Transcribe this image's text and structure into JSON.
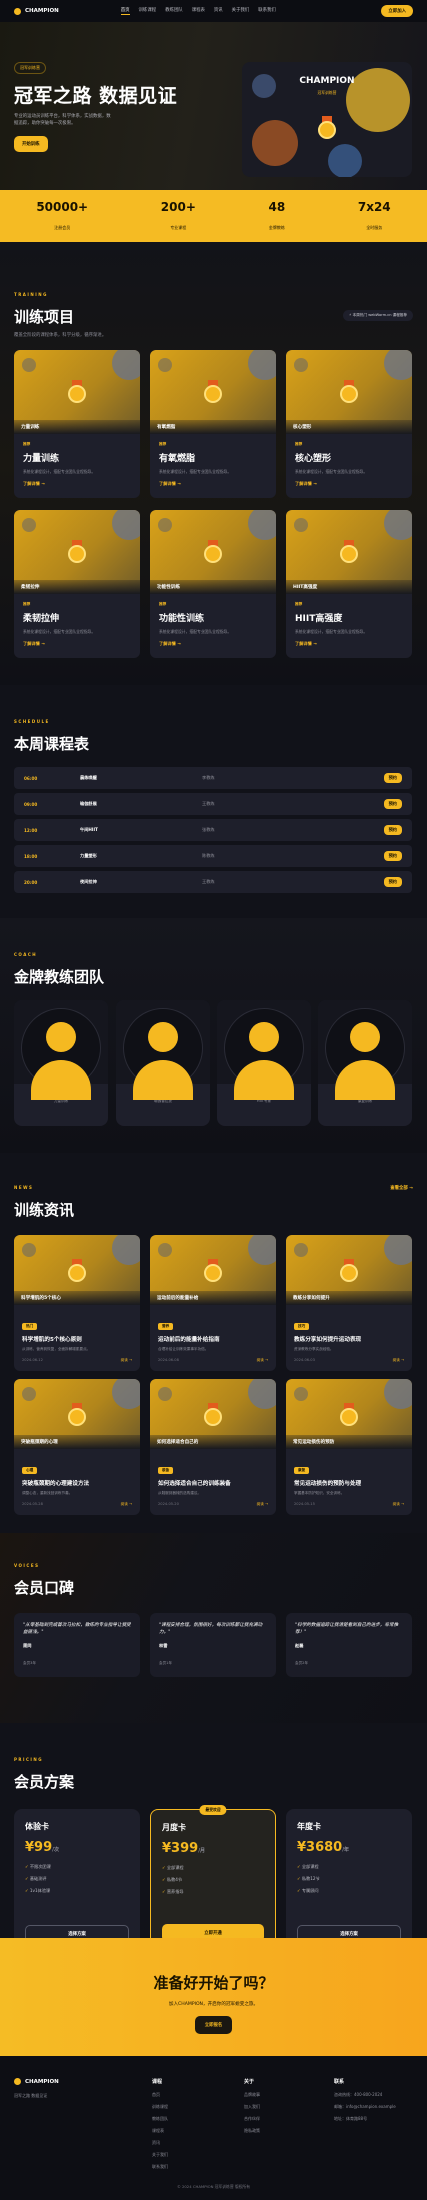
{
  "brand": {
    "name": "CHAMPION"
  },
  "nav": {
    "items": [
      "首页",
      "训练课程",
      "教练团队",
      "课程表",
      "资讯",
      "关于我们",
      "联系我们"
    ],
    "cta": "立即加入"
  },
  "hero": {
    "badge": "冠军训练营",
    "title": "冠军之路 数据见证",
    "desc": "专业的运动员训练平台，科学体系，实战数据，数据追踪，助你突破每一次极限。",
    "button": "开始训练",
    "card_title": "CHAMPION",
    "card_sub": "冠军训练营"
  },
  "stats": [
    {
      "value": "50000+",
      "label": "注册会员"
    },
    {
      "value": "200+",
      "label": "专业课程"
    },
    {
      "value": "48",
      "label": "金牌教练"
    },
    {
      "value": "7x24",
      "label": "全时服务"
    }
  ],
  "training": {
    "eyebrow": "TRAINING",
    "title": "训练项目",
    "sub": "覆盖全阶段的课程体系，科学分级，循序渐进。",
    "chip": "⚡ 本周热门 webWorm.cn 课程推荐",
    "items": [
      {
        "cap": "力量训练",
        "tag": "推荐",
        "title": "力量训练",
        "desc": "系统化课程设计，搭配专业团队全程指导。",
        "more": "了解详情 →"
      },
      {
        "cap": "有氧燃脂",
        "tag": "推荐",
        "title": "有氧燃脂",
        "desc": "系统化课程设计，搭配专业团队全程指导。",
        "more": "了解详情 →"
      },
      {
        "cap": "核心塑形",
        "tag": "推荐",
        "title": "核心塑形",
        "desc": "系统化课程设计，搭配专业团队全程指导。",
        "more": "了解详情 →"
      },
      {
        "cap": "柔韧拉伸",
        "tag": "推荐",
        "title": "柔韧拉伸",
        "desc": "系统化课程设计，搭配专业团队全程指导。",
        "more": "了解详情 →"
      },
      {
        "cap": "功能性训练",
        "tag": "推荐",
        "title": "功能性训练",
        "desc": "系统化课程设计，搭配专业团队全程指导。",
        "more": "了解详情 →"
      },
      {
        "cap": "HIIT高强度",
        "tag": "推荐",
        "title": "HIIT高强度",
        "desc": "系统化课程设计，搭配专业团队全程指导。",
        "more": "了解详情 →"
      }
    ]
  },
  "schedule": {
    "eyebrow": "SCHEDULE",
    "title": "本周课程表",
    "rows": [
      {
        "time": "06:00",
        "course": "晨练唤醒",
        "coach": "李教练",
        "btn": "预约"
      },
      {
        "time": "09:00",
        "course": "瑜伽舒展",
        "coach": "王教练",
        "btn": "预约"
      },
      {
        "time": "12:00",
        "course": "午间HIIT",
        "coach": "张教练",
        "btn": "预约"
      },
      {
        "time": "18:00",
        "course": "力量塑形",
        "coach": "陈教练",
        "btn": "预约"
      },
      {
        "time": "20:00",
        "course": "夜间拉伸",
        "coach": "王教练",
        "btn": "预约"
      }
    ]
  },
  "coaches": {
    "eyebrow": "COACH",
    "title": "金牌教练团队",
    "items": [
      {
        "name": "李教练",
        "role": "力量训练"
      },
      {
        "name": "王教练",
        "role": "瑜伽普拉提"
      },
      {
        "name": "张教练",
        "role": "HIIT专家"
      },
      {
        "name": "陈教练",
        "role": "康复训练"
      }
    ]
  },
  "news": {
    "eyebrow": "NEWS",
    "title": "训练资讯",
    "more": "查看全部 →",
    "items": [
      {
        "cap": "科学增肌的5个核心",
        "tag": "热门",
        "title": "科学增肌的5个核心原则",
        "desc": "从训练、营养到恢复，全面拆解增肌要点。",
        "date": "2024-06-12",
        "read": "阅读 →"
      },
      {
        "cap": "运动前后的能量补给",
        "tag": "营养",
        "title": "运动前后的能量补给指南",
        "desc": "合理补给让训练效果事半功倍。",
        "date": "2024-06-08",
        "read": "阅读 →"
      },
      {
        "cap": "教练分享如何提升",
        "tag": "技巧",
        "title": "教练分享如何提升运动表现",
        "desc": "资深教练分享实战经验。",
        "date": "2024-06-03",
        "read": "阅读 →"
      },
      {
        "cap": "突破瓶颈期的心理",
        "tag": "心理",
        "title": "突破瓶颈期的心理建设方法",
        "desc": "调整心态，重新找回训练节奏。",
        "date": "2024-05-28",
        "read": "阅读 →"
      },
      {
        "cap": "如何选择适合自己的",
        "tag": "装备",
        "title": "如何选择适合自己的训练装备",
        "desc": "从鞋服到器械的选购建议。",
        "date": "2024-05-20",
        "read": "阅读 →"
      },
      {
        "cap": "常见运动损伤的预防",
        "tag": "康复",
        "title": "常见运动损伤的预防与处理",
        "desc": "掌握基本防护知识，安全训练。",
        "date": "2024-05-15",
        "read": "阅读 →"
      }
    ]
  },
  "voices": {
    "eyebrow": "VOICES",
    "title": "会员口碑",
    "items": [
      {
        "quote": "\"从零基础到完成首次马拉松，教练的专业指导让我受益匪浅。\"",
        "name": "周同",
        "role": "会员3年"
      },
      {
        "quote": "\"课程安排合理，氛围很好，每次训练都让我充满动力。\"",
        "name": "林雪",
        "role": "会员1年"
      },
      {
        "quote": "\"科学的数据追踪让我清楚看到自己的进步，非常推荐！\"",
        "name": "赵磊",
        "role": "会员2年"
      }
    ]
  },
  "pricing": {
    "eyebrow": "PRICING",
    "title": "会员方案",
    "hot": "最受欢迎",
    "plans": [
      {
        "name": "体验卡",
        "price": "¥99",
        "unit": "/次",
        "features": [
          "不限次团课",
          "基础测评",
          "1v1体验课"
        ],
        "btn": "选择方案"
      },
      {
        "name": "月度卡",
        "price": "¥399",
        "unit": "/月",
        "features": [
          "全部课程",
          "私教4节",
          "营养指导"
        ],
        "btn": "立即开通"
      },
      {
        "name": "年度卡",
        "price": "¥3680",
        "unit": "/年",
        "features": [
          "全部课程",
          "私教12节",
          "专属顾问"
        ],
        "btn": "选择方案"
      }
    ]
  },
  "cta": {
    "title": "准备好开始了吗？",
    "desc": "加入CHAMPION，开启你的冠军蜕变之旅。",
    "button": "立即报名"
  },
  "footer": {
    "tagline": "冠军之路 数据见证",
    "cols": [
      {
        "title": "课程",
        "links": [
          "首页",
          "训练课程",
          "教练团队",
          "课程表",
          "资讯",
          "关于我们",
          "联系我们"
        ]
      },
      {
        "title": "关于",
        "links": [
          "品牌故事",
          "加入我们",
          "合作伙伴",
          "隐私政策"
        ]
      },
      {
        "title": "联系",
        "links": [
          "咨询热线：400-800-2024",
          "邮箱：info@champion.example",
          "地址：体育路88号"
        ]
      }
    ],
    "copyright": "© 2024 CHAMPION 冠军训练营 版权所有"
  },
  "colors": {
    "accent": "#f5b921",
    "bg": "#0d0e14",
    "card": "#1e1f2b"
  }
}
